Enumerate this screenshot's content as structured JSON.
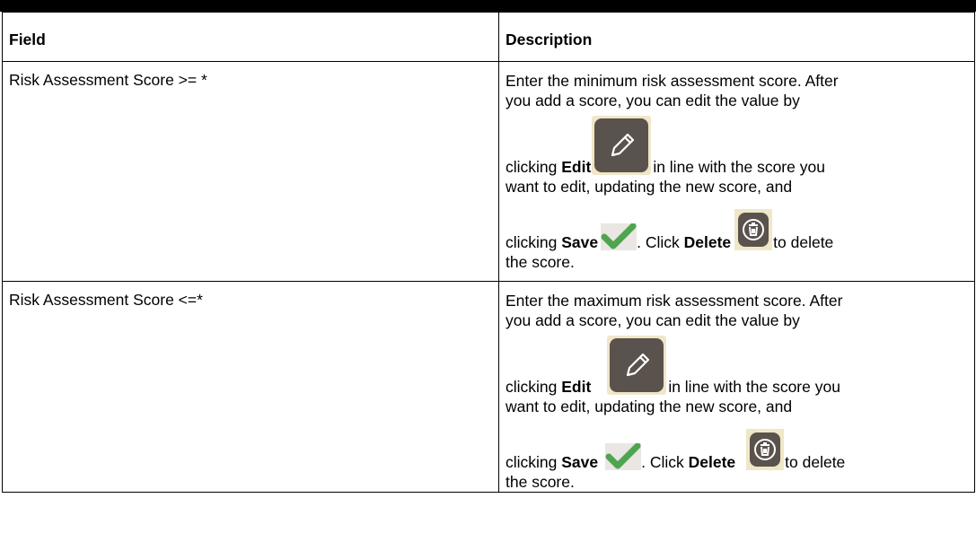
{
  "table": {
    "headers": {
      "field": "Field",
      "description": "Description"
    },
    "rows": [
      {
        "field": "Risk Assessment Score >= *",
        "desc_line1": "Enter the minimum risk assessment score. After",
        "desc_line2": "you add a score, you can edit the value by",
        "clicking": "clicking ",
        "edit_label": "Edit",
        "after_edit": "in line with the score you",
        "desc_line4": "want to edit, updating the new score, and",
        "save_label": "Save",
        "click_text": ". Click ",
        "delete_label": "Delete",
        "to_delete": "to delete",
        "desc_last": "the score."
      },
      {
        "field": "Risk Assessment Score <=*",
        "desc_line1": "Enter the maximum risk assessment score. After",
        "desc_line2": "you add a score, you can edit the value by",
        "clicking": "clicking ",
        "edit_label": "Edit",
        "after_edit": "in line with the score you",
        "desc_line4": "want to edit, updating the new score, and",
        "save_label": "Save",
        "click_text": ". Click ",
        "delete_label": "Delete",
        "to_delete": "to delete",
        "desc_last": "the score."
      }
    ]
  },
  "icons": {
    "edit": "pencil-icon",
    "save": "checkmark-icon",
    "delete": "trash-icon"
  },
  "colors": {
    "icon_background": "#5a524d",
    "icon_frame": "#f0e6c8",
    "check_green": "#4fa54f"
  }
}
